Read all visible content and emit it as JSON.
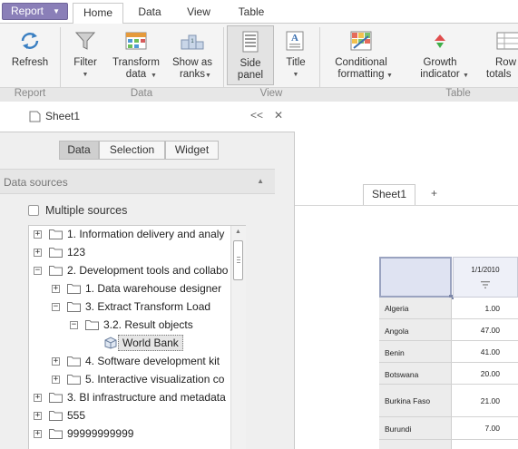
{
  "ribbon": {
    "report_label": "Report",
    "tabs": [
      "Home",
      "Data",
      "View",
      "Table"
    ],
    "buttons": {
      "refresh": "Refresh",
      "filter": "Filter",
      "transform_1": "Transform",
      "transform_2": "data",
      "ranks_1": "Show as",
      "ranks_2": "ranks",
      "side_1": "Side",
      "side_2": "panel",
      "title": "Title",
      "cond_1": "Conditional",
      "cond_2": "formatting",
      "growth_1": "Growth",
      "growth_2": "indicator",
      "rowtot_1": "Row",
      "rowtot_2": "totals"
    },
    "groups": {
      "report": "Report",
      "data": "Data",
      "view": "View",
      "table": "Table"
    }
  },
  "side_panel": {
    "sheet_title": "Sheet1",
    "collapse_glyph": "<<",
    "close_glyph": "✕",
    "segments": [
      "Data",
      "Selection",
      "Widget"
    ],
    "active_segment": "Data",
    "data_sources_title": "Data sources",
    "multiple_sources_label": "Multiple sources",
    "multiple_sources_checked": false,
    "tree": [
      {
        "label": "1. Information delivery and analy",
        "expander": "+"
      },
      {
        "label": "123",
        "expander": "+"
      },
      {
        "label": "2. Development tools and collabo",
        "expander": "−"
      },
      {
        "label": "1. Data warehouse designer",
        "expander": "+"
      },
      {
        "label": "3. Extract Transform Load",
        "expander": "−"
      },
      {
        "label": "3.2. Result objects",
        "expander": "−"
      },
      {
        "label": "World Bank",
        "expander": "",
        "selected": true
      },
      {
        "label": "4. Software development kit",
        "expander": "+"
      },
      {
        "label": "5. Interactive visualization co",
        "expander": "+"
      },
      {
        "label": "3. BI infrastructure and metadata",
        "expander": "+"
      },
      {
        "label": "555",
        "expander": "+"
      },
      {
        "label": "99999999999",
        "expander": "+"
      }
    ]
  },
  "workspace": {
    "sheet_tab": "Sheet1",
    "add_sheet": "+",
    "grid": {
      "column_header": "1/1/2010",
      "rows": [
        {
          "label": "Algeria",
          "value": "1.00"
        },
        {
          "label": "Angola",
          "value": "47.00"
        },
        {
          "label": "Benin",
          "value": "41.00"
        },
        {
          "label": "Botswana",
          "value": "20.00"
        },
        {
          "label": "Burkina Faso",
          "value": "21.00"
        },
        {
          "label": "Burundi",
          "value": "7.00"
        }
      ]
    }
  },
  "colors": {
    "report_button": "#8a7fb8",
    "panel_bg": "#efefef",
    "grid_corner": "#dfe3f2"
  }
}
